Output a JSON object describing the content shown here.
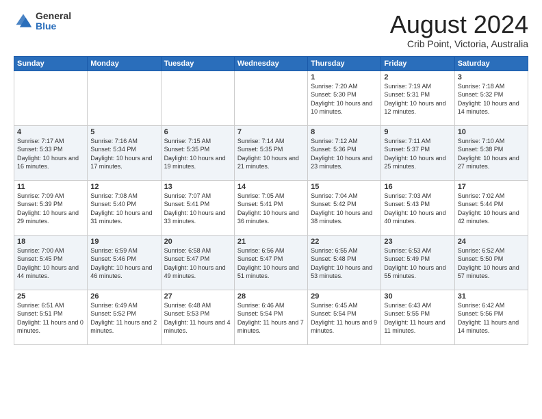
{
  "header": {
    "logo_general": "General",
    "logo_blue": "Blue",
    "month_title": "August 2024",
    "location": "Crib Point, Victoria, Australia"
  },
  "weekdays": [
    "Sunday",
    "Monday",
    "Tuesday",
    "Wednesday",
    "Thursday",
    "Friday",
    "Saturday"
  ],
  "weeks": [
    [
      {
        "day": "",
        "info": ""
      },
      {
        "day": "",
        "info": ""
      },
      {
        "day": "",
        "info": ""
      },
      {
        "day": "",
        "info": ""
      },
      {
        "day": "1",
        "info": "Sunrise: 7:20 AM\nSunset: 5:30 PM\nDaylight: 10 hours\nand 10 minutes."
      },
      {
        "day": "2",
        "info": "Sunrise: 7:19 AM\nSunset: 5:31 PM\nDaylight: 10 hours\nand 12 minutes."
      },
      {
        "day": "3",
        "info": "Sunrise: 7:18 AM\nSunset: 5:32 PM\nDaylight: 10 hours\nand 14 minutes."
      }
    ],
    [
      {
        "day": "4",
        "info": "Sunrise: 7:17 AM\nSunset: 5:33 PM\nDaylight: 10 hours\nand 16 minutes."
      },
      {
        "day": "5",
        "info": "Sunrise: 7:16 AM\nSunset: 5:34 PM\nDaylight: 10 hours\nand 17 minutes."
      },
      {
        "day": "6",
        "info": "Sunrise: 7:15 AM\nSunset: 5:35 PM\nDaylight: 10 hours\nand 19 minutes."
      },
      {
        "day": "7",
        "info": "Sunrise: 7:14 AM\nSunset: 5:35 PM\nDaylight: 10 hours\nand 21 minutes."
      },
      {
        "day": "8",
        "info": "Sunrise: 7:12 AM\nSunset: 5:36 PM\nDaylight: 10 hours\nand 23 minutes."
      },
      {
        "day": "9",
        "info": "Sunrise: 7:11 AM\nSunset: 5:37 PM\nDaylight: 10 hours\nand 25 minutes."
      },
      {
        "day": "10",
        "info": "Sunrise: 7:10 AM\nSunset: 5:38 PM\nDaylight: 10 hours\nand 27 minutes."
      }
    ],
    [
      {
        "day": "11",
        "info": "Sunrise: 7:09 AM\nSunset: 5:39 PM\nDaylight: 10 hours\nand 29 minutes."
      },
      {
        "day": "12",
        "info": "Sunrise: 7:08 AM\nSunset: 5:40 PM\nDaylight: 10 hours\nand 31 minutes."
      },
      {
        "day": "13",
        "info": "Sunrise: 7:07 AM\nSunset: 5:41 PM\nDaylight: 10 hours\nand 33 minutes."
      },
      {
        "day": "14",
        "info": "Sunrise: 7:05 AM\nSunset: 5:41 PM\nDaylight: 10 hours\nand 36 minutes."
      },
      {
        "day": "15",
        "info": "Sunrise: 7:04 AM\nSunset: 5:42 PM\nDaylight: 10 hours\nand 38 minutes."
      },
      {
        "day": "16",
        "info": "Sunrise: 7:03 AM\nSunset: 5:43 PM\nDaylight: 10 hours\nand 40 minutes."
      },
      {
        "day": "17",
        "info": "Sunrise: 7:02 AM\nSunset: 5:44 PM\nDaylight: 10 hours\nand 42 minutes."
      }
    ],
    [
      {
        "day": "18",
        "info": "Sunrise: 7:00 AM\nSunset: 5:45 PM\nDaylight: 10 hours\nand 44 minutes."
      },
      {
        "day": "19",
        "info": "Sunrise: 6:59 AM\nSunset: 5:46 PM\nDaylight: 10 hours\nand 46 minutes."
      },
      {
        "day": "20",
        "info": "Sunrise: 6:58 AM\nSunset: 5:47 PM\nDaylight: 10 hours\nand 49 minutes."
      },
      {
        "day": "21",
        "info": "Sunrise: 6:56 AM\nSunset: 5:47 PM\nDaylight: 10 hours\nand 51 minutes."
      },
      {
        "day": "22",
        "info": "Sunrise: 6:55 AM\nSunset: 5:48 PM\nDaylight: 10 hours\nand 53 minutes."
      },
      {
        "day": "23",
        "info": "Sunrise: 6:53 AM\nSunset: 5:49 PM\nDaylight: 10 hours\nand 55 minutes."
      },
      {
        "day": "24",
        "info": "Sunrise: 6:52 AM\nSunset: 5:50 PM\nDaylight: 10 hours\nand 57 minutes."
      }
    ],
    [
      {
        "day": "25",
        "info": "Sunrise: 6:51 AM\nSunset: 5:51 PM\nDaylight: 11 hours\nand 0 minutes."
      },
      {
        "day": "26",
        "info": "Sunrise: 6:49 AM\nSunset: 5:52 PM\nDaylight: 11 hours\nand 2 minutes."
      },
      {
        "day": "27",
        "info": "Sunrise: 6:48 AM\nSunset: 5:53 PM\nDaylight: 11 hours\nand 4 minutes."
      },
      {
        "day": "28",
        "info": "Sunrise: 6:46 AM\nSunset: 5:54 PM\nDaylight: 11 hours\nand 7 minutes."
      },
      {
        "day": "29",
        "info": "Sunrise: 6:45 AM\nSunset: 5:54 PM\nDaylight: 11 hours\nand 9 minutes."
      },
      {
        "day": "30",
        "info": "Sunrise: 6:43 AM\nSunset: 5:55 PM\nDaylight: 11 hours\nand 11 minutes."
      },
      {
        "day": "31",
        "info": "Sunrise: 6:42 AM\nSunset: 5:56 PM\nDaylight: 11 hours\nand 14 minutes."
      }
    ]
  ]
}
